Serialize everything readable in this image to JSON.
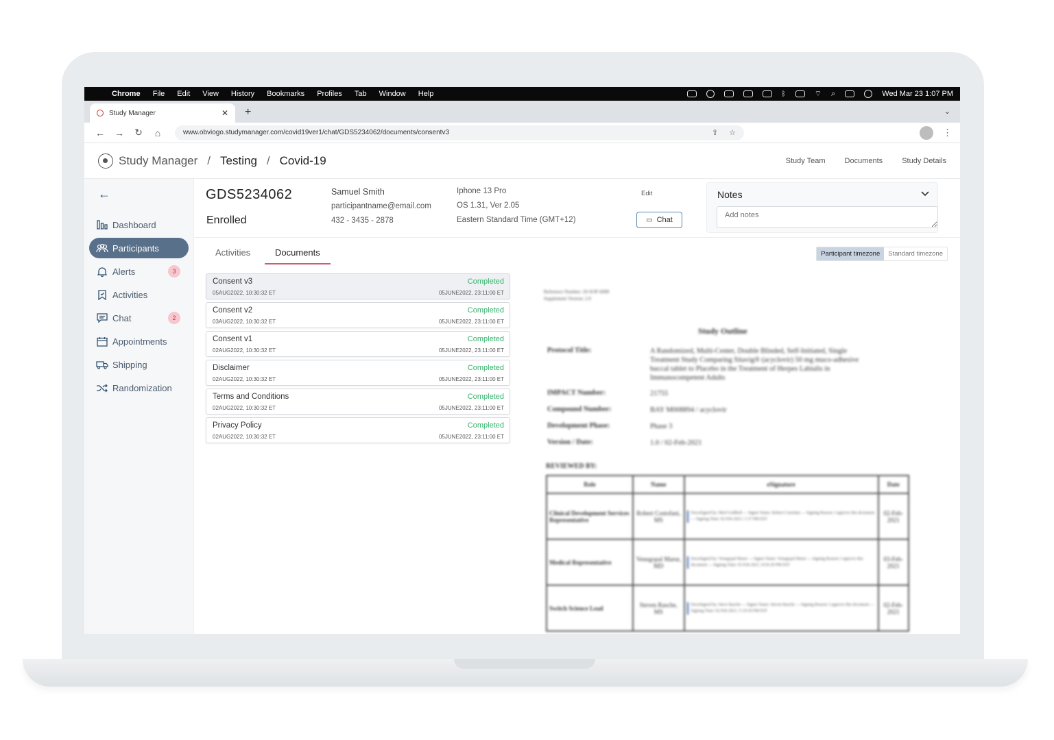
{
  "menubar": {
    "items": [
      "Chrome",
      "File",
      "Edit",
      "View",
      "History",
      "Bookmarks",
      "Profiles",
      "Tab",
      "Window",
      "Help"
    ],
    "datetime": "Wed Mar 23  1:07 PM"
  },
  "browser": {
    "tab_title": "Study Manager",
    "url": "www.obviogo.studymanager.com/covid19ver1/chat/GDS5234062/documents/consentv3"
  },
  "header": {
    "app_name": "Study Manager",
    "sep": "/",
    "crumbs": [
      "Testing",
      "Covid-19"
    ],
    "nav": [
      "Study Team",
      "Documents",
      "Study Details"
    ]
  },
  "sidebar": {
    "items": [
      {
        "label": "Dashboard",
        "icon": "bar-chart-icon"
      },
      {
        "label": "Participants",
        "icon": "users-icon",
        "active": true
      },
      {
        "label": "Alerts",
        "icon": "bell-icon",
        "badge": "3"
      },
      {
        "label": "Activities",
        "icon": "bookmark-icon"
      },
      {
        "label": "Chat",
        "icon": "chat-icon",
        "badge": "2"
      },
      {
        "label": "Appointments",
        "icon": "calendar-icon"
      },
      {
        "label": "Shipping",
        "icon": "truck-icon"
      },
      {
        "label": "Randomization",
        "icon": "shuffle-icon"
      }
    ]
  },
  "participant": {
    "id": "GDS5234062",
    "status": "Enrolled",
    "name": "Samuel Smith",
    "email": "participantname@email.com",
    "phone": "432 - 3435 - 2878",
    "device": "Iphone 13 Pro",
    "os": "OS 1.31, Ver 2.05",
    "timezone": "Eastern Standard Time (GMT+12)",
    "edit_label": "Edit",
    "chat_label": "Chat"
  },
  "notes": {
    "title": "Notes",
    "placeholder": "Add notes"
  },
  "tabs": [
    "Activities",
    "Documents"
  ],
  "timezone_toggle": [
    "Participant timezone",
    "Standard timezone"
  ],
  "documents": [
    {
      "name": "Consent v3",
      "status": "Completed",
      "start": "05AUG2022, 10:30:32 ET",
      "end": "05JUNE2022, 23:11:00 ET"
    },
    {
      "name": "Consent v2",
      "status": "Completed",
      "start": "03AUG2022, 10:30:32 ET",
      "end": "05JUNE2022, 23:11:00 ET"
    },
    {
      "name": "Consent v1",
      "status": "Completed",
      "start": "02AUG2022, 10:30:32 ET",
      "end": "05JUNE2022, 23:11:00 ET"
    },
    {
      "name": "Disclaimer",
      "status": "Completed",
      "start": "02AUG2022, 10:30:32 ET",
      "end": "05JUNE2022, 23:11:00 ET"
    },
    {
      "name": "Terms and Conditions",
      "status": "Completed",
      "start": "02AUG2022, 10:30:32 ET",
      "end": "05JUNE2022, 23:11:00 ET"
    },
    {
      "name": "Privacy Policy",
      "status": "Completed",
      "start": "02AUG2022, 10:30:32 ET",
      "end": "05JUNE2022, 23:11:00 ET"
    }
  ],
  "preview": {
    "reference": "Reference Number: 20-SOP-6008",
    "supplement": "Supplement Version: 2.0",
    "title": "Study Outline",
    "fields": [
      {
        "k": "Protocol Title:",
        "v": "A Randomized, Multi-Center, Double Blinded, Self-Initiated, Single Treatment Study Comparing Sitavig® (acyclovir) 50 mg muco-adhesive buccal tablet to Placebo in the Treatment of Herpes Labialis in Immunocompetent Adults"
      },
      {
        "k": "IMPACT Number:",
        "v": "21755"
      },
      {
        "k": "Compound Number:",
        "v": "BAY M008894 / acyclovir"
      },
      {
        "k": "Development Phase:",
        "v": "Phase 3"
      },
      {
        "k": "Version / Date:",
        "v": "1.0 / 02-Feb-2021"
      }
    ],
    "reviewed_by": "REVIEWED BY:",
    "table_headers": [
      "Role",
      "Name",
      "eSignature",
      "Date"
    ],
    "rows": [
      {
        "role": "Clinical Development Services Representative",
        "name": "Robert Costofani, MS",
        "sig": "DocuSigned by: Merl Goldbell — Signer Name: Robert Costofani — Signing Reason: I approve this document — Signing Time: 02-Feb-2021 | 1:37 PM EST",
        "date": "02-Feb-2021"
      },
      {
        "role": "Medical Representative",
        "name": "Venugopal Marur, MD",
        "sig": "DocuSigned by: Venugopal Marur — Signer Name: Venugopal Marur — Signing Reason: I approve this document — Signing Time: 03-Feb-2021 | 8:56:30 PM EST",
        "date": "03-Feb-2021"
      },
      {
        "role": "Switch Science Lead",
        "name": "Steven Rasche, MS",
        "sig": "DocuSigned by: Steve Rasche — Signer Name: Steven Rasche — Signing Reason: I approve this document — Signing Time: 02-Feb-2021 | 5:10:30 PM EST",
        "date": "02-Feb-2021"
      }
    ]
  }
}
